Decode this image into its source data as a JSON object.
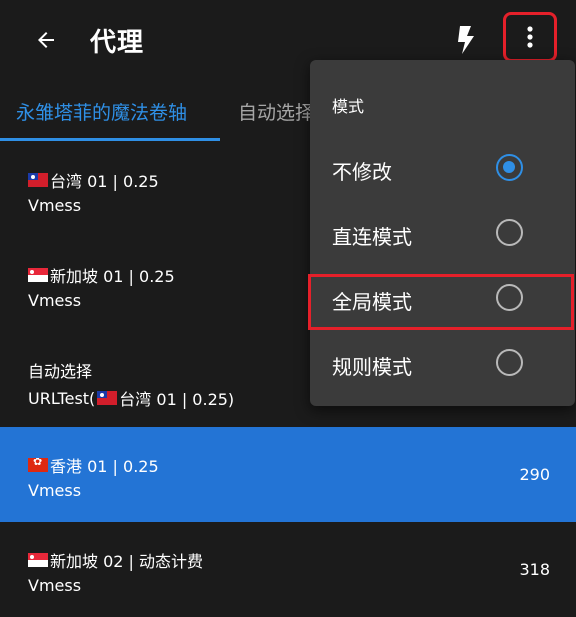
{
  "app": {
    "title": "代理"
  },
  "tabs": [
    {
      "label": "永雏塔菲的魔法卷轴",
      "active": true
    },
    {
      "label": "自动选择",
      "active": false
    }
  ],
  "proxies": [
    {
      "flag": "taiwan-flag-icon",
      "name": "台湾 01 | 0.25",
      "type": "Vmess",
      "delay": "",
      "selected": false
    },
    {
      "flag": "singapore-flag-icon",
      "name": "新加坡 01 | 0.25",
      "type": "Vmess",
      "delay": "",
      "selected": false
    },
    {
      "flag": "",
      "name": "自动选择",
      "type_prefix": "URLTest(",
      "type_flag": "taiwan-flag-icon",
      "type_suffix": "台湾 01 | 0.25)",
      "delay": "",
      "selected": false
    },
    {
      "flag": "hongkong-flag-icon",
      "name": "香港 01 | 0.25",
      "type": "Vmess",
      "delay": "290",
      "selected": true
    },
    {
      "flag": "singapore-flag-icon",
      "name": "新加坡 02 | 动态计费",
      "type": "Vmess",
      "delay": "318",
      "selected": false
    }
  ],
  "mode_menu": {
    "header": "模式",
    "options": [
      {
        "label": "不修改",
        "checked": true
      },
      {
        "label": "直连模式",
        "checked": false
      },
      {
        "label": "全局模式",
        "checked": false
      },
      {
        "label": "规则模式",
        "checked": false
      }
    ]
  },
  "colors": {
    "background": "#1b1b1b",
    "accent": "#2f8fe5",
    "selected_row": "#2374d5",
    "menu_background": "#3b3b3b",
    "annotation_red": "#e5202a"
  },
  "icons": {
    "back": "arrow-left-icon",
    "bolt": "lightning-bolt-icon",
    "more": "more-vertical-icon"
  }
}
